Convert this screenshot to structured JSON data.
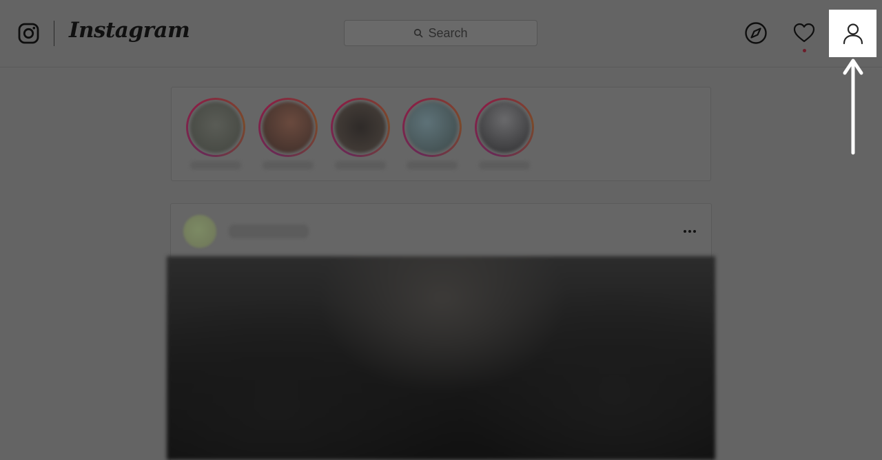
{
  "header": {
    "logo_text": "Instagram",
    "search_placeholder": "Search",
    "icons": [
      "instagram-glyph-icon",
      "search-icon",
      "explore-compass-icon",
      "heart-icon",
      "profile-icon"
    ]
  },
  "stories": [
    {
      "avatar_color": "#4c4f48"
    },
    {
      "avatar_color": "#4a3530"
    },
    {
      "avatar_color": "#3e3834"
    },
    {
      "avatar_color": "#4a5a5e"
    },
    {
      "avatar_color": "#3c3c3e"
    }
  ],
  "colors": {
    "overlay_background": "#646464",
    "highlight": "#ffffff",
    "story_ring": "#8a2045",
    "notification_dot": "#6e1d2a"
  }
}
